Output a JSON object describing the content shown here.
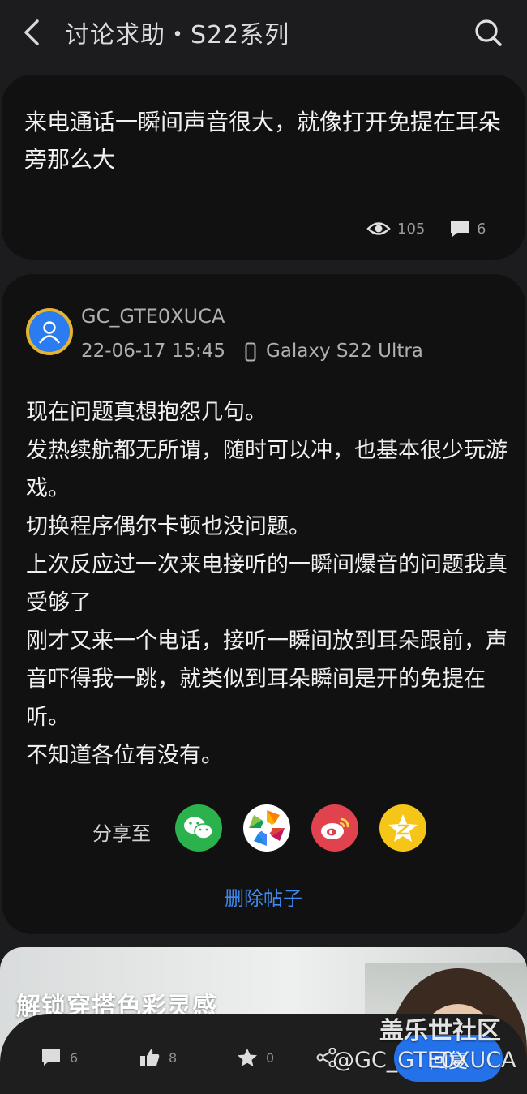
{
  "header": {
    "title": "讨论求助・S22系列",
    "back_icon": "chevron-left-icon",
    "search_icon": "search-icon"
  },
  "question": {
    "text": "来电通话一瞬间声音很大，就像打开免提在耳朵旁那么大",
    "views": "105",
    "comments": "6"
  },
  "post": {
    "username": "GC_GTE0XUCA",
    "date": "22-06-17 15:45",
    "device": "Galaxy S22 Ultra",
    "lines": [
      "现在问题真想抱怨几句。",
      "发热续航都无所谓，随时可以冲，也基本很少玩游戏。",
      "切换程序偶尔卡顿也没问题。",
      "上次反应过一次来电接听的一瞬间爆音的问题我真受够了",
      "刚才又来一个电话，接听一瞬间放到耳朵跟前，声音吓得我一跳，就类似到耳朵瞬间是开的免提在听。",
      "不知道各位有没有。"
    ],
    "share_label": "分享至",
    "share_targets": [
      "wechat-icon",
      "moments-icon",
      "weibo-icon",
      "qzone-icon"
    ],
    "delete_label": "删除帖子"
  },
  "banner": {
    "title": "解锁穿搭色彩灵感"
  },
  "bottom": {
    "comments": "6",
    "likes": "8",
    "favorites": "0",
    "reply_label": "回复"
  },
  "watermark": {
    "community": "盖乐世社区",
    "user": "@GC_GTE0XUCA"
  },
  "colors": {
    "accent": "#2472ea",
    "link": "#3e8af0",
    "background": "#1c1c1e",
    "card": "#111111"
  }
}
